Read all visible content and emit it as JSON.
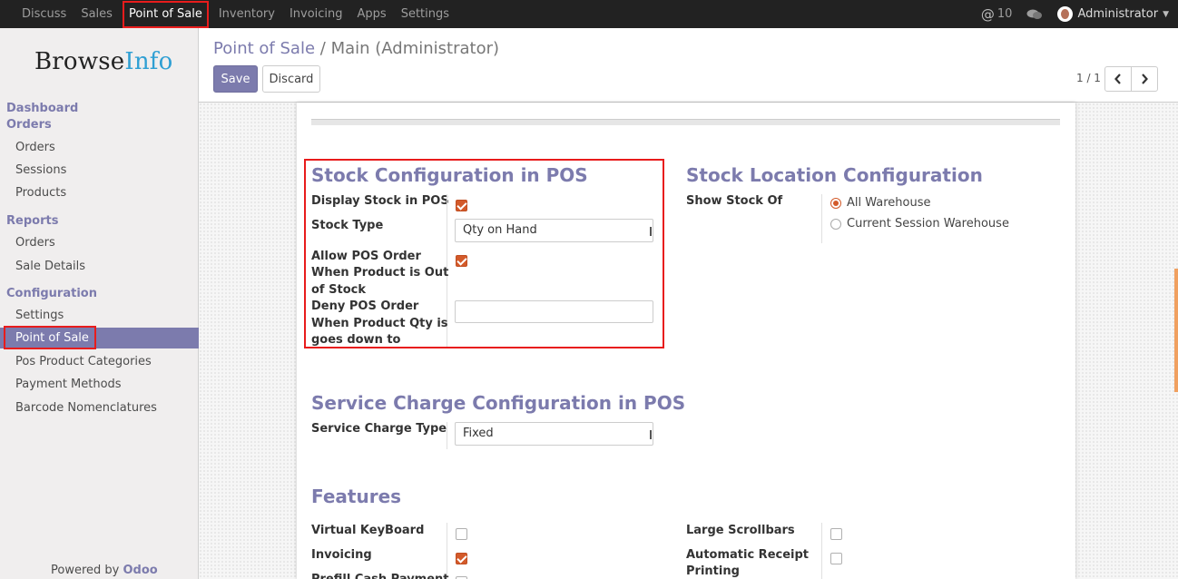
{
  "topnav": {
    "items": [
      "Discuss",
      "Sales",
      "Point of Sale",
      "Inventory",
      "Invoicing",
      "Apps",
      "Settings"
    ],
    "mentions_count": "10",
    "user": "Administrator"
  },
  "sidebar": {
    "logo_part1": "Browse",
    "logo_part2": "Info",
    "sections": [
      {
        "title": "Dashboard"
      },
      {
        "title": "Orders",
        "items": [
          "Orders",
          "Sessions",
          "Products"
        ]
      },
      {
        "title": "Reports",
        "items": [
          "Orders",
          "Sale Details"
        ]
      },
      {
        "title": "Configuration",
        "items": [
          "Settings",
          "Point of Sale",
          "Pos Product Categories",
          "Payment Methods",
          "Barcode Nomenclatures"
        ]
      }
    ],
    "powered_prefix": "Powered by",
    "powered_brand": "Odoo"
  },
  "control_panel": {
    "breadcrumb_link": "Point of Sale",
    "breadcrumb_sep": "/",
    "breadcrumb_current": "Main (Administrator)",
    "save_label": "Save",
    "discard_label": "Discard",
    "pager": "1 / 1"
  },
  "form": {
    "stock_config": {
      "title": "Stock Configuration in POS",
      "display_stock_label": "Display Stock in POS",
      "display_stock_checked": true,
      "stock_type_label": "Stock Type",
      "stock_type_value": "Qty on Hand",
      "allow_order_label_1": "Allow POS Order",
      "allow_order_label_2": "When Product is Out",
      "allow_order_label_3": "of Stock",
      "allow_order_checked": true,
      "deny_order_label_1": "Deny POS Order",
      "deny_order_label_2": "When Product Qty is",
      "deny_order_label_3": "goes down to",
      "deny_order_value": ""
    },
    "stock_location": {
      "title": "Stock Location Configuration",
      "show_stock_label": "Show Stock Of",
      "options": [
        "All Warehouse",
        "Current Session Warehouse"
      ],
      "selected": "All Warehouse"
    },
    "service_charge": {
      "title": "Service Charge Configuration in POS",
      "type_label": "Service Charge Type",
      "type_value": "Fixed"
    },
    "features": {
      "title": "Features",
      "virtual_keyboard_label": "Virtual KeyBoard",
      "invoicing_label": "Invoicing",
      "prefill_label": "Prefill Cash Payment",
      "large_scrollbars_label": "Large Scrollbars",
      "auto_receipt_label_1": "Automatic Receipt",
      "auto_receipt_label_2": "Printing"
    }
  },
  "colors": {
    "accent": "#7c7bad",
    "checkbox_on": "#d35a2a",
    "highlight_box": "#e81c1c"
  }
}
